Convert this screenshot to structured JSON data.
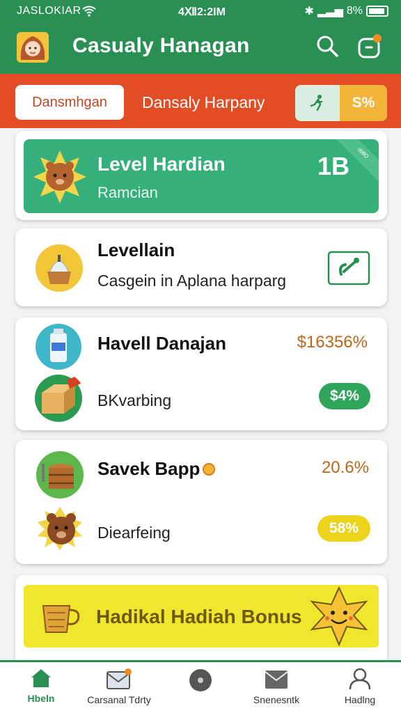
{
  "status_bar": {
    "carrier": "JASLOKIAR",
    "time": "4Ⅻ2:2IM",
    "battery": "8%"
  },
  "app": {
    "title": "Casualy Hanagan"
  },
  "tabs": {
    "active_label": "Dansmhgan",
    "second_label": "Dansaly Harpany",
    "toggle_label": "S%"
  },
  "banner": {
    "title": "Level Hardian",
    "subtitle": "Ramcian",
    "number": "1B",
    "ribbon": "ᵒᵇᴮᴼ"
  },
  "items": [
    {
      "title": "Levellain",
      "subtitle": "Casgein in Aplana harparg"
    },
    {
      "title": "Havell Danajan",
      "value": "$16356%",
      "subtitle": "BKvarbing",
      "pill": "$4%"
    },
    {
      "title": "Savek Bapp",
      "value": "20.6%",
      "subtitle": "Diearfeing",
      "pill": "58%"
    }
  ],
  "bonus": {
    "title": "Hadikal Hadiah Bonus"
  },
  "nav": [
    {
      "label": "Hbeln"
    },
    {
      "label": "Carsanal Tdrty"
    },
    {
      "label": ""
    },
    {
      "label": "Snenesntk"
    },
    {
      "label": "Hadlng"
    }
  ],
  "colors": {
    "primary_green": "#2a8f52",
    "orange_red": "#e24d25",
    "banner_green": "#36b07b",
    "yellow": "#f0e62e",
    "accent_orange": "#f3b43a"
  }
}
